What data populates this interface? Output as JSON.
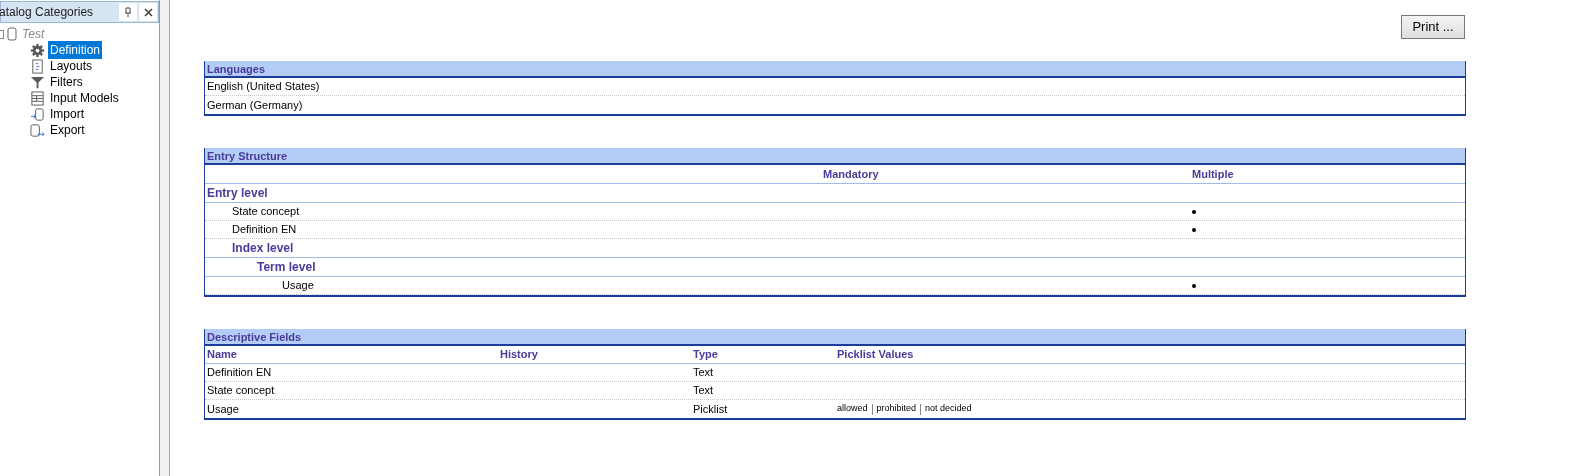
{
  "panel": {
    "title": "atalog Categories",
    "tree": [
      {
        "label": "Test",
        "selected": false,
        "children": [
          {
            "label": "Definition",
            "selected": true
          },
          {
            "label": "Layouts",
            "selected": false
          },
          {
            "label": "Filters",
            "selected": false
          },
          {
            "label": "Input Models",
            "selected": false
          },
          {
            "label": "Import",
            "selected": false
          },
          {
            "label": "Export",
            "selected": false
          }
        ]
      }
    ]
  },
  "print_button": "Print ...",
  "languages": {
    "title": "Languages",
    "rows": [
      "English (United States)",
      "German (Germany)"
    ]
  },
  "entry_structure": {
    "title": "Entry Structure",
    "columns": [
      "Mandatory",
      "Multiple"
    ],
    "rows": [
      {
        "kind": "level",
        "label": "Entry level",
        "children": [
          {
            "kind": "field",
            "label": "State concept",
            "mandatory": false,
            "multiple": true
          },
          {
            "kind": "field",
            "label": "Definition EN",
            "mandatory": false,
            "multiple": true
          },
          {
            "kind": "level",
            "label": "Index level",
            "children": [
              {
                "kind": "level",
                "label": "Term level",
                "children": [
                  {
                    "kind": "field",
                    "label": "Usage",
                    "mandatory": false,
                    "multiple": true
                  }
                ]
              }
            ]
          }
        ]
      }
    ]
  },
  "descriptive_fields": {
    "title": "Descriptive Fields",
    "columns": [
      "Name",
      "History",
      "Type",
      "Picklist Values"
    ],
    "rows": [
      {
        "name": "Definition EN",
        "type": "Text",
        "picklist_values": []
      },
      {
        "name": "State concept",
        "type": "Text",
        "picklist_values": []
      },
      {
        "name": "Usage",
        "type": "Picklist",
        "picklist_values": [
          "allowed",
          "prohibited",
          "not decided"
        ]
      }
    ]
  }
}
